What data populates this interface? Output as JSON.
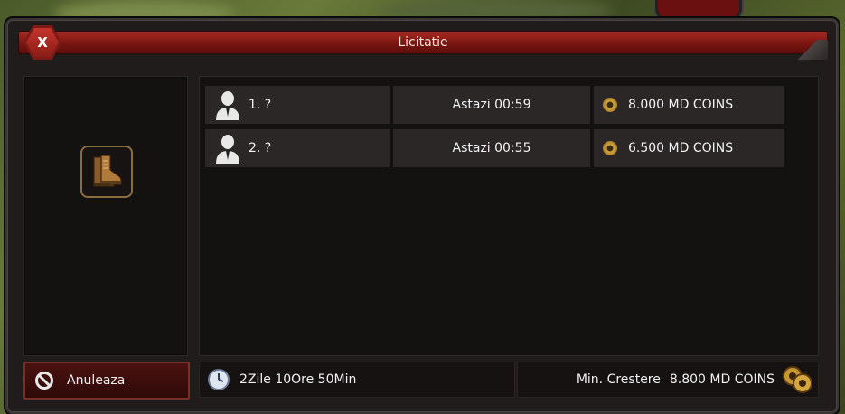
{
  "window": {
    "title": "Licitatie",
    "close_label": "X"
  },
  "item": {
    "icon": "leather-boots-icon"
  },
  "bids": [
    {
      "rank_name": "1. ?",
      "time": "Astazi 00:59",
      "amount": "8.000 MD COINS"
    },
    {
      "rank_name": "2. ?",
      "time": "Astazi 00:55",
      "amount": "6.500 MD COINS"
    }
  ],
  "footer": {
    "cancel_label": "Anuleaza",
    "time_left": "2Zile 10Ore 50Min",
    "min_increase_label": "Min. Crestere",
    "min_increase_value": "8.800 MD COINS"
  },
  "colors": {
    "title_bar": "#8a1c16",
    "panel_bg": "#141111",
    "row_bg": "#2a2726",
    "accent_gold": "#d6a640"
  }
}
